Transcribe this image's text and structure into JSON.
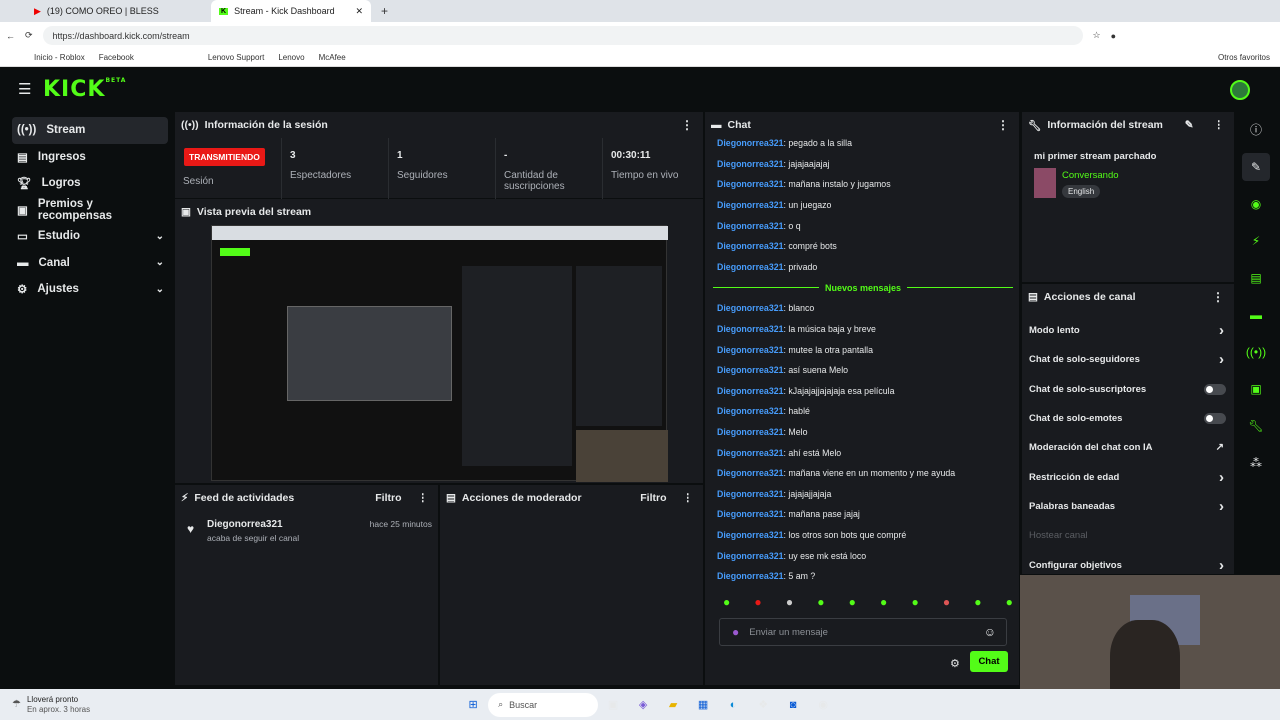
{
  "browser": {
    "tabs": [
      "(19) COMO OREO | BLESS",
      "Stream - Kick Dashboard"
    ],
    "url": "https://dashboard.kick.com/stream",
    "bookmarks": [
      "Inicio - Roblox",
      "Facebook",
      "Lenovo Support",
      "Lenovo",
      "McAfee"
    ],
    "other_favorites": "Otros favoritos"
  },
  "app": {
    "logo": "KICK",
    "beta": "BETA"
  },
  "sidebar": {
    "items": [
      {
        "label": "Stream",
        "icon": "stream-icon"
      },
      {
        "label": "Ingresos",
        "icon": "revenue-icon"
      },
      {
        "label": "Logros",
        "icon": "trophy-icon"
      },
      {
        "label": "Premios y recompensas",
        "icon": "gift-icon"
      },
      {
        "label": "Estudio",
        "icon": "studio-icon"
      },
      {
        "label": "Canal",
        "icon": "channel-icon"
      },
      {
        "label": "Ajustes",
        "icon": "gear-icon"
      }
    ]
  },
  "session": {
    "title": "Información de la sesión",
    "live_badge": "TRANSMITIENDO",
    "stats": [
      {
        "value": "",
        "label": "Sesión"
      },
      {
        "value": "3",
        "label": "Espectadores"
      },
      {
        "value": "1",
        "label": "Seguidores"
      },
      {
        "value": "-",
        "label": "Cantidad de suscripciones"
      },
      {
        "value": "00:30:11",
        "label": "Tiempo en vivo"
      }
    ]
  },
  "preview": {
    "title": "Vista previa del stream"
  },
  "activity": {
    "title": "Feed de actividades",
    "filter": "Filtro",
    "user": "Diegonorrea321",
    "time": "hace 25 minutos",
    "action": "acaba de seguir el canal"
  },
  "moderator": {
    "title": "Acciones de moderador",
    "filter": "Filtro"
  },
  "chat": {
    "title": "Chat",
    "new_messages": "Nuevos mensajes",
    "placeholder": "Enviar un mensaje",
    "send": "Chat",
    "messages_before": [
      {
        "user": "Diegonorrea321",
        "text": ": pegado a la silla"
      },
      {
        "user": "Diegonorrea321",
        "text": ": jajajaajajaj"
      },
      {
        "user": "Diegonorrea321",
        "text": ": mañana instalo y jugamos"
      },
      {
        "user": "Diegonorrea321",
        "text": ": un juegazo"
      },
      {
        "user": "Diegonorrea321",
        "text": ": o q"
      },
      {
        "user": "Diegonorrea321",
        "text": ": compré bots"
      },
      {
        "user": "Diegonorrea321",
        "text": ": privado"
      }
    ],
    "messages_after": [
      {
        "user": "Diegonorrea321",
        "text": ": blanco"
      },
      {
        "user": "Diegonorrea321",
        "text": ": la música baja y breve"
      },
      {
        "user": "Diegonorrea321",
        "text": ": mutee la otra pantalla"
      },
      {
        "user": "Diegonorrea321",
        "text": ": así suena Melo"
      },
      {
        "user": "Diegonorrea321",
        "text": ": kJajajajjajajaja esa película"
      },
      {
        "user": "Diegonorrea321",
        "text": ": hablé"
      },
      {
        "user": "Diegonorrea321",
        "text": ": Melo"
      },
      {
        "user": "Diegonorrea321",
        "text": ": ahí está Melo"
      },
      {
        "user": "Diegonorrea321",
        "text": ": mañana viene en un momento y me ayuda"
      },
      {
        "user": "Diegonorrea321",
        "text": ": jajajajjajaja"
      },
      {
        "user": "Diegonorrea321",
        "text": ": mañana pase jajaj"
      },
      {
        "user": "Diegonorrea321",
        "text": ": los otros son bots que compré"
      },
      {
        "user": "Diegonorrea321",
        "text": ": uy ese mk está loco"
      },
      {
        "user": "Diegonorrea321",
        "text": ": 5 am ?"
      }
    ]
  },
  "stream_info": {
    "title": "Información del stream",
    "stream_title": "mi primer stream parchado",
    "category": "Conversando",
    "language": "English"
  },
  "channel_actions": {
    "title": "Acciones de canal",
    "items": [
      {
        "label": "Modo lento",
        "control": "chevron"
      },
      {
        "label": "Chat de solo-seguidores",
        "control": "chevron"
      },
      {
        "label": "Chat de solo-suscriptores",
        "control": "toggle"
      },
      {
        "label": "Chat de solo-emotes",
        "control": "toggle"
      },
      {
        "label": "Moderación del chat con IA",
        "control": "external"
      },
      {
        "label": "Restricción de edad",
        "control": "chevron"
      },
      {
        "label": "Palabras baneadas",
        "control": "chevron"
      },
      {
        "label": "Hostear canal",
        "control": "disabled"
      },
      {
        "label": "Configurar objetivos",
        "control": "chevron"
      }
    ]
  },
  "taskbar": {
    "weather": "Lloverá pronto",
    "weather_sub": "En aprox. 3 horas",
    "search": "Buscar"
  },
  "colors": {
    "accent": "#53fc18",
    "live": "#e91916",
    "username": "#479cfb",
    "panel": "#191b1f"
  }
}
